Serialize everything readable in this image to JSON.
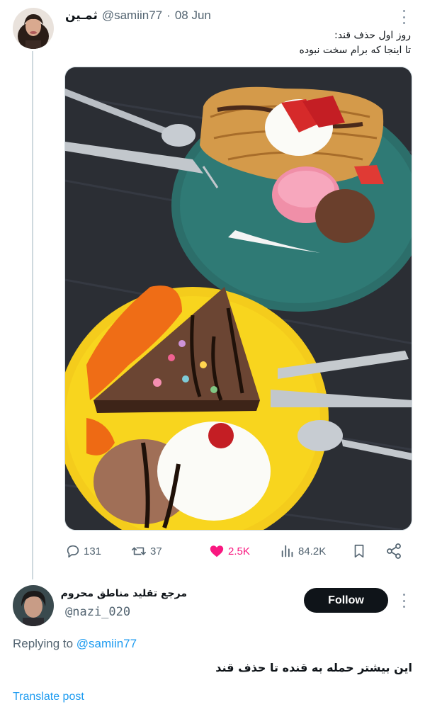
{
  "tweet": {
    "display_name": "ثمـین",
    "handle": "@samiin77",
    "separator": "·",
    "date": "08 Jun",
    "text_line1": "روز اول حذف قند:",
    "text_line2": "تا اینجا که برام سخت نبوده",
    "media_icon": "food-photo",
    "actions": {
      "replies": "131",
      "retweets": "37",
      "likes": "2.5K",
      "views": "84.2K"
    }
  },
  "reply": {
    "display_name": "مرجع تقلید مناطق محروم",
    "handle": "@nazi_020",
    "follow_label": "Follow",
    "replying_prefix": "Replying to",
    "replying_to": "@samiin77",
    "text": "این بیشتر حمله به قنده تا حذف قند",
    "translate_label": "Translate post"
  },
  "colors": {
    "accent": "#1d9bf0",
    "like": "#f91880",
    "muted": "#536471",
    "thread_line": "#cfd9de"
  }
}
